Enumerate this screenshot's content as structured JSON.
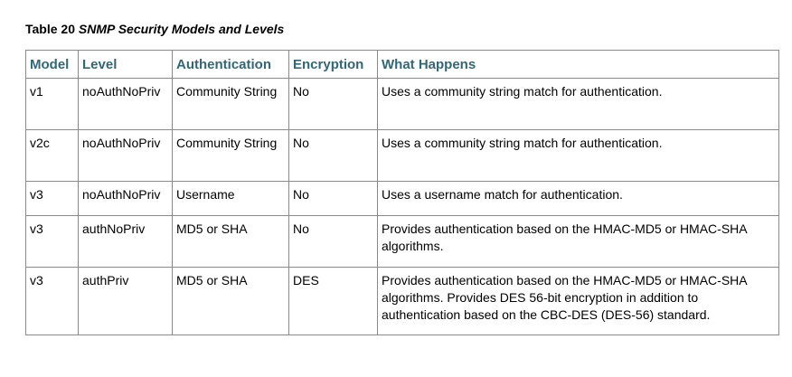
{
  "caption": {
    "number": "Table 20",
    "title": "SNMP Security Models and Levels"
  },
  "table": {
    "headers": [
      "Model",
      "Level",
      "Authentication",
      "Encryption",
      "What Happens"
    ],
    "rows": [
      [
        "v1",
        "noAuthNoPriv",
        "Community String",
        "No",
        "Uses a community string match for authentication."
      ],
      [
        "v2c",
        "noAuthNoPriv",
        "Community String",
        "No",
        "Uses a community string match for authentication."
      ],
      [
        "v3",
        "noAuthNoPriv",
        "Username",
        "No",
        "Uses a username match for authentication."
      ],
      [
        "v3",
        "authNoPriv",
        "MD5 or SHA",
        "No",
        "Provides authentication based on the HMAC-MD5 or HMAC-SHA algorithms."
      ],
      [
        "v3",
        "authPriv",
        "MD5 or SHA",
        "DES",
        "Provides authentication based on the HMAC-MD5 or HMAC-SHA algorithms. Provides DES 56-bit encryption in addition to authentication based on the CBC-DES (DES-56) standard."
      ]
    ]
  },
  "colors": {
    "header_text": "#336677",
    "border": "#8a8a8a"
  }
}
